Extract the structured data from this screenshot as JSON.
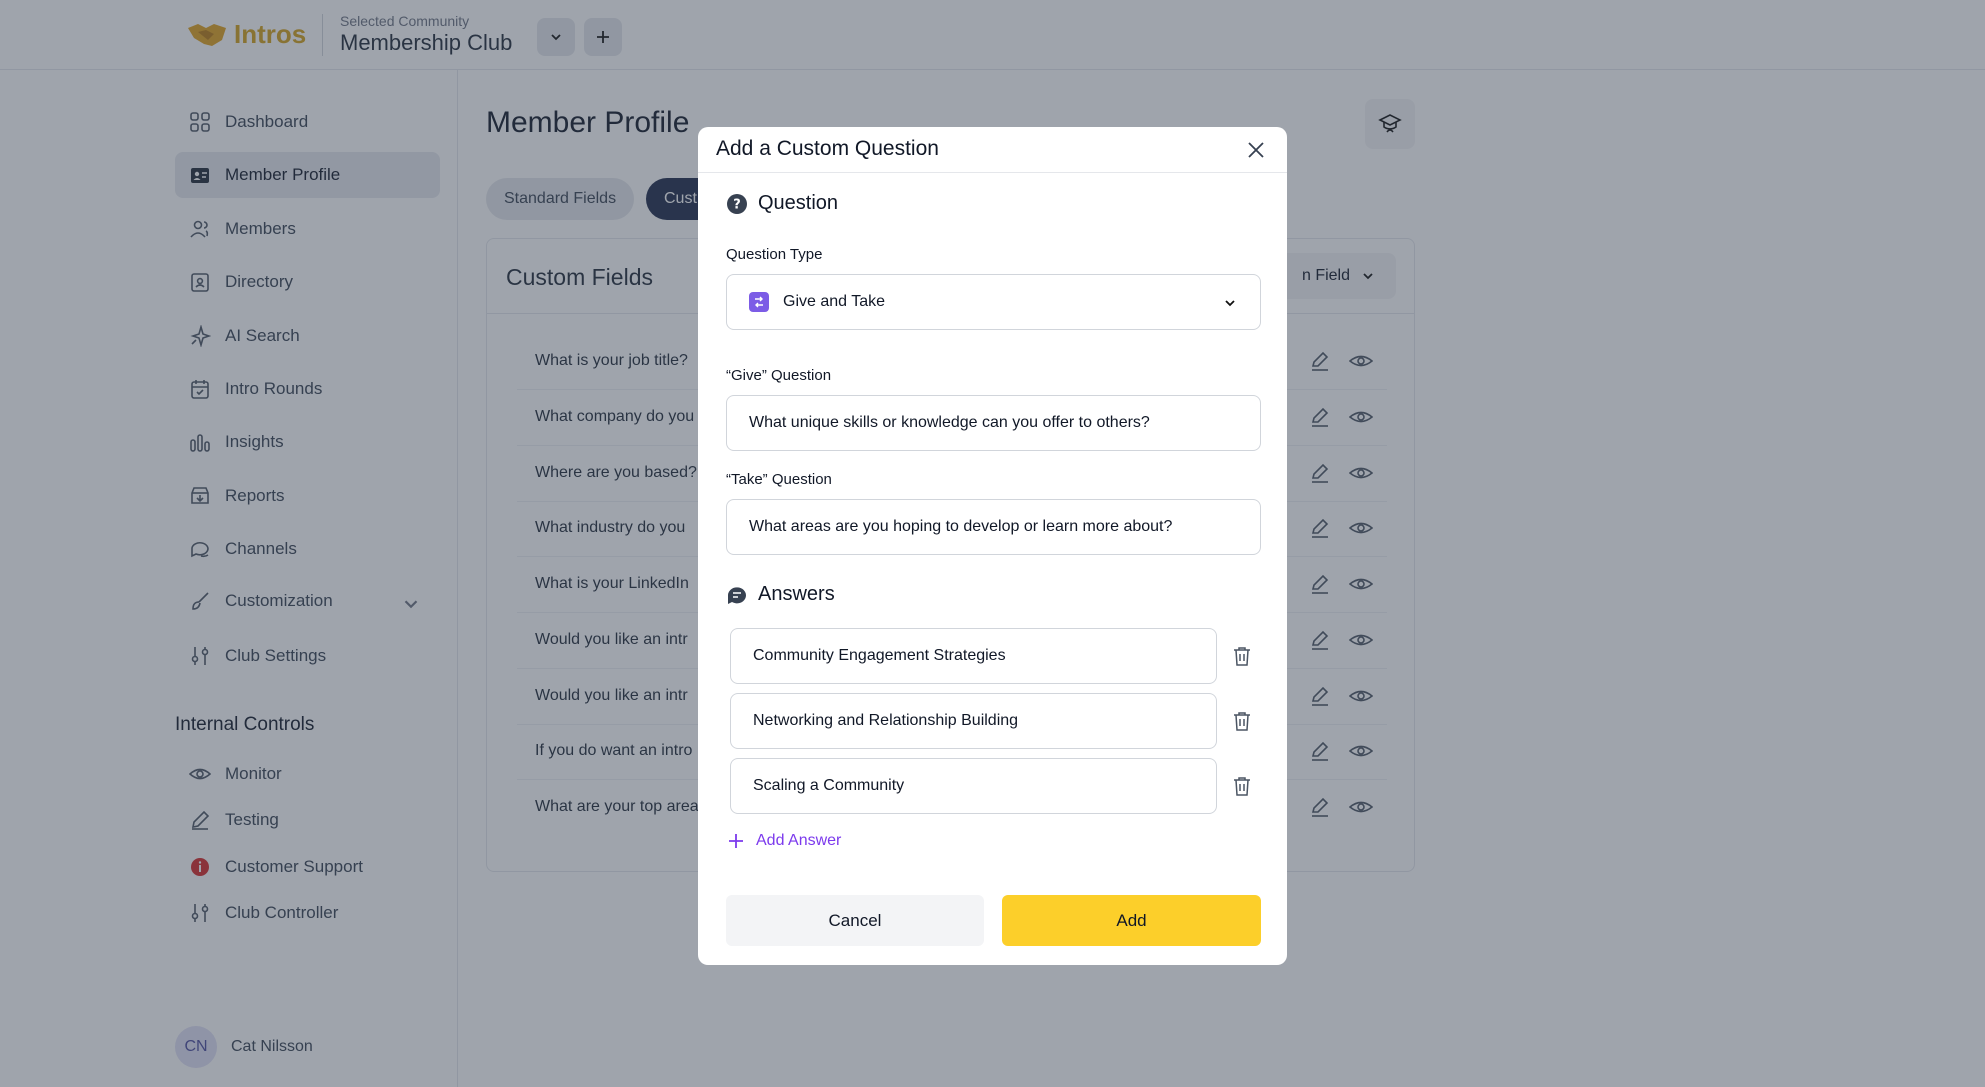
{
  "app": {
    "logo_text": "Intros",
    "community_label": "Selected Community",
    "community_name": "Membership Club"
  },
  "sidebar": {
    "items": [
      {
        "label": "Dashboard",
        "icon": "grid-icon"
      },
      {
        "label": "Member Profile",
        "icon": "id-card-icon",
        "active": true
      },
      {
        "label": "Members",
        "icon": "users-icon"
      },
      {
        "label": "Directory",
        "icon": "directory-icon"
      },
      {
        "label": "AI Search",
        "icon": "sparkle-icon"
      },
      {
        "label": "Intro Rounds",
        "icon": "calendar-icon"
      },
      {
        "label": "Insights",
        "icon": "bar-chart-icon"
      },
      {
        "label": "Reports",
        "icon": "inbox-download-icon"
      },
      {
        "label": "Channels",
        "icon": "chat-icon"
      },
      {
        "label": "Customization",
        "icon": "brush-icon"
      },
      {
        "label": "Club Settings",
        "icon": "sliders-icon"
      }
    ],
    "internal_title": "Internal Controls",
    "internal_items": [
      {
        "label": "Monitor",
        "icon": "eye-icon"
      },
      {
        "label": "Testing",
        "icon": "pencil-icon"
      },
      {
        "label": "Customer Support",
        "icon": "info-alert-icon"
      },
      {
        "label": "Club Controller",
        "icon": "sliders-icon"
      }
    ],
    "user": {
      "initials": "CN",
      "name": "Cat Nilsson"
    }
  },
  "main": {
    "title": "Member Profile",
    "tabs": [
      "Standard Fields",
      "Cust"
    ],
    "card_title": "Custom Fields",
    "add_field_label": "n Field",
    "rows": [
      "What is your job title?",
      "What company do you",
      "Where are you based?",
      "What industry do you",
      "What is your LinkedIn",
      "Would you like an intr",
      "Would you like an intr",
      "If you do want an intro",
      "What are your top area"
    ]
  },
  "modal": {
    "title": "Add a Custom Question",
    "question_section": "Question",
    "question_type_label": "Question Type",
    "question_type_value": "Give and Take",
    "give_label": "“Give” Question",
    "give_value": "What unique skills or knowledge can you offer to others?",
    "take_label": "“Take” Question",
    "take_value": "What areas are you hoping to develop or learn more about?",
    "answers_section": "Answers",
    "answers": [
      "Community Engagement Strategies",
      "Networking and Relationship Building",
      "Scaling a Community"
    ],
    "add_answer_label": "Add Answer",
    "cancel_label": "Cancel",
    "add_label": "Add"
  },
  "colors": {
    "accent_yellow": "#fccf2a",
    "accent_purple": "#7c3aed",
    "active_tab": "#1e2a4a",
    "overlay": "rgba(55,65,81,0.48)"
  }
}
